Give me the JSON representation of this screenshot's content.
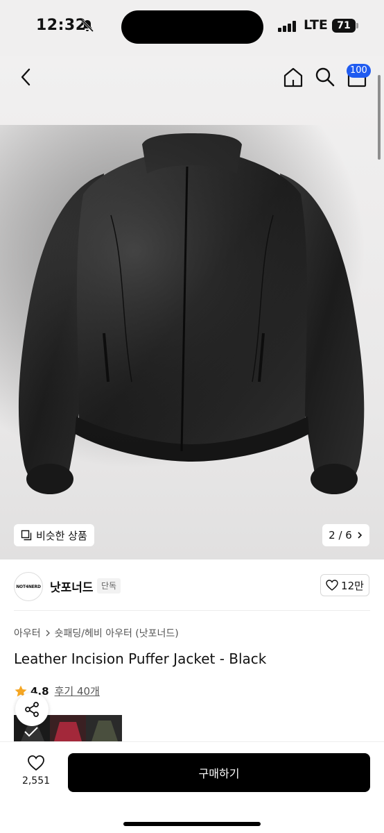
{
  "status_bar": {
    "time": "12:32",
    "network": "LTE",
    "battery": "71"
  },
  "nav": {
    "cart_count": "100"
  },
  "gallery": {
    "similar_label": "비슷한 상품",
    "pager": "2 / 6"
  },
  "brand": {
    "logo_text": "NOT4NERD",
    "name": "낫포너드",
    "badge": "단독",
    "likes": "12만"
  },
  "product": {
    "breadcrumb": [
      "아우터",
      "숏패딩/헤비 아우터 (낫포너드)"
    ],
    "title": "Leather Incision Puffer Jacket - Black",
    "rating": "4.8",
    "reviews": "후기 40개"
  },
  "bottom": {
    "wish_count": "2,551",
    "buy_label": "구매하기"
  },
  "colors": {
    "accent": "#1f5bf0",
    "buy_button": "#000000",
    "star": "#f5a623"
  },
  "icons": [
    "back-icon",
    "home-icon",
    "search-icon",
    "cart-icon",
    "similar-icon",
    "chevron-right-icon",
    "heart-icon",
    "star-icon",
    "share-icon"
  ]
}
